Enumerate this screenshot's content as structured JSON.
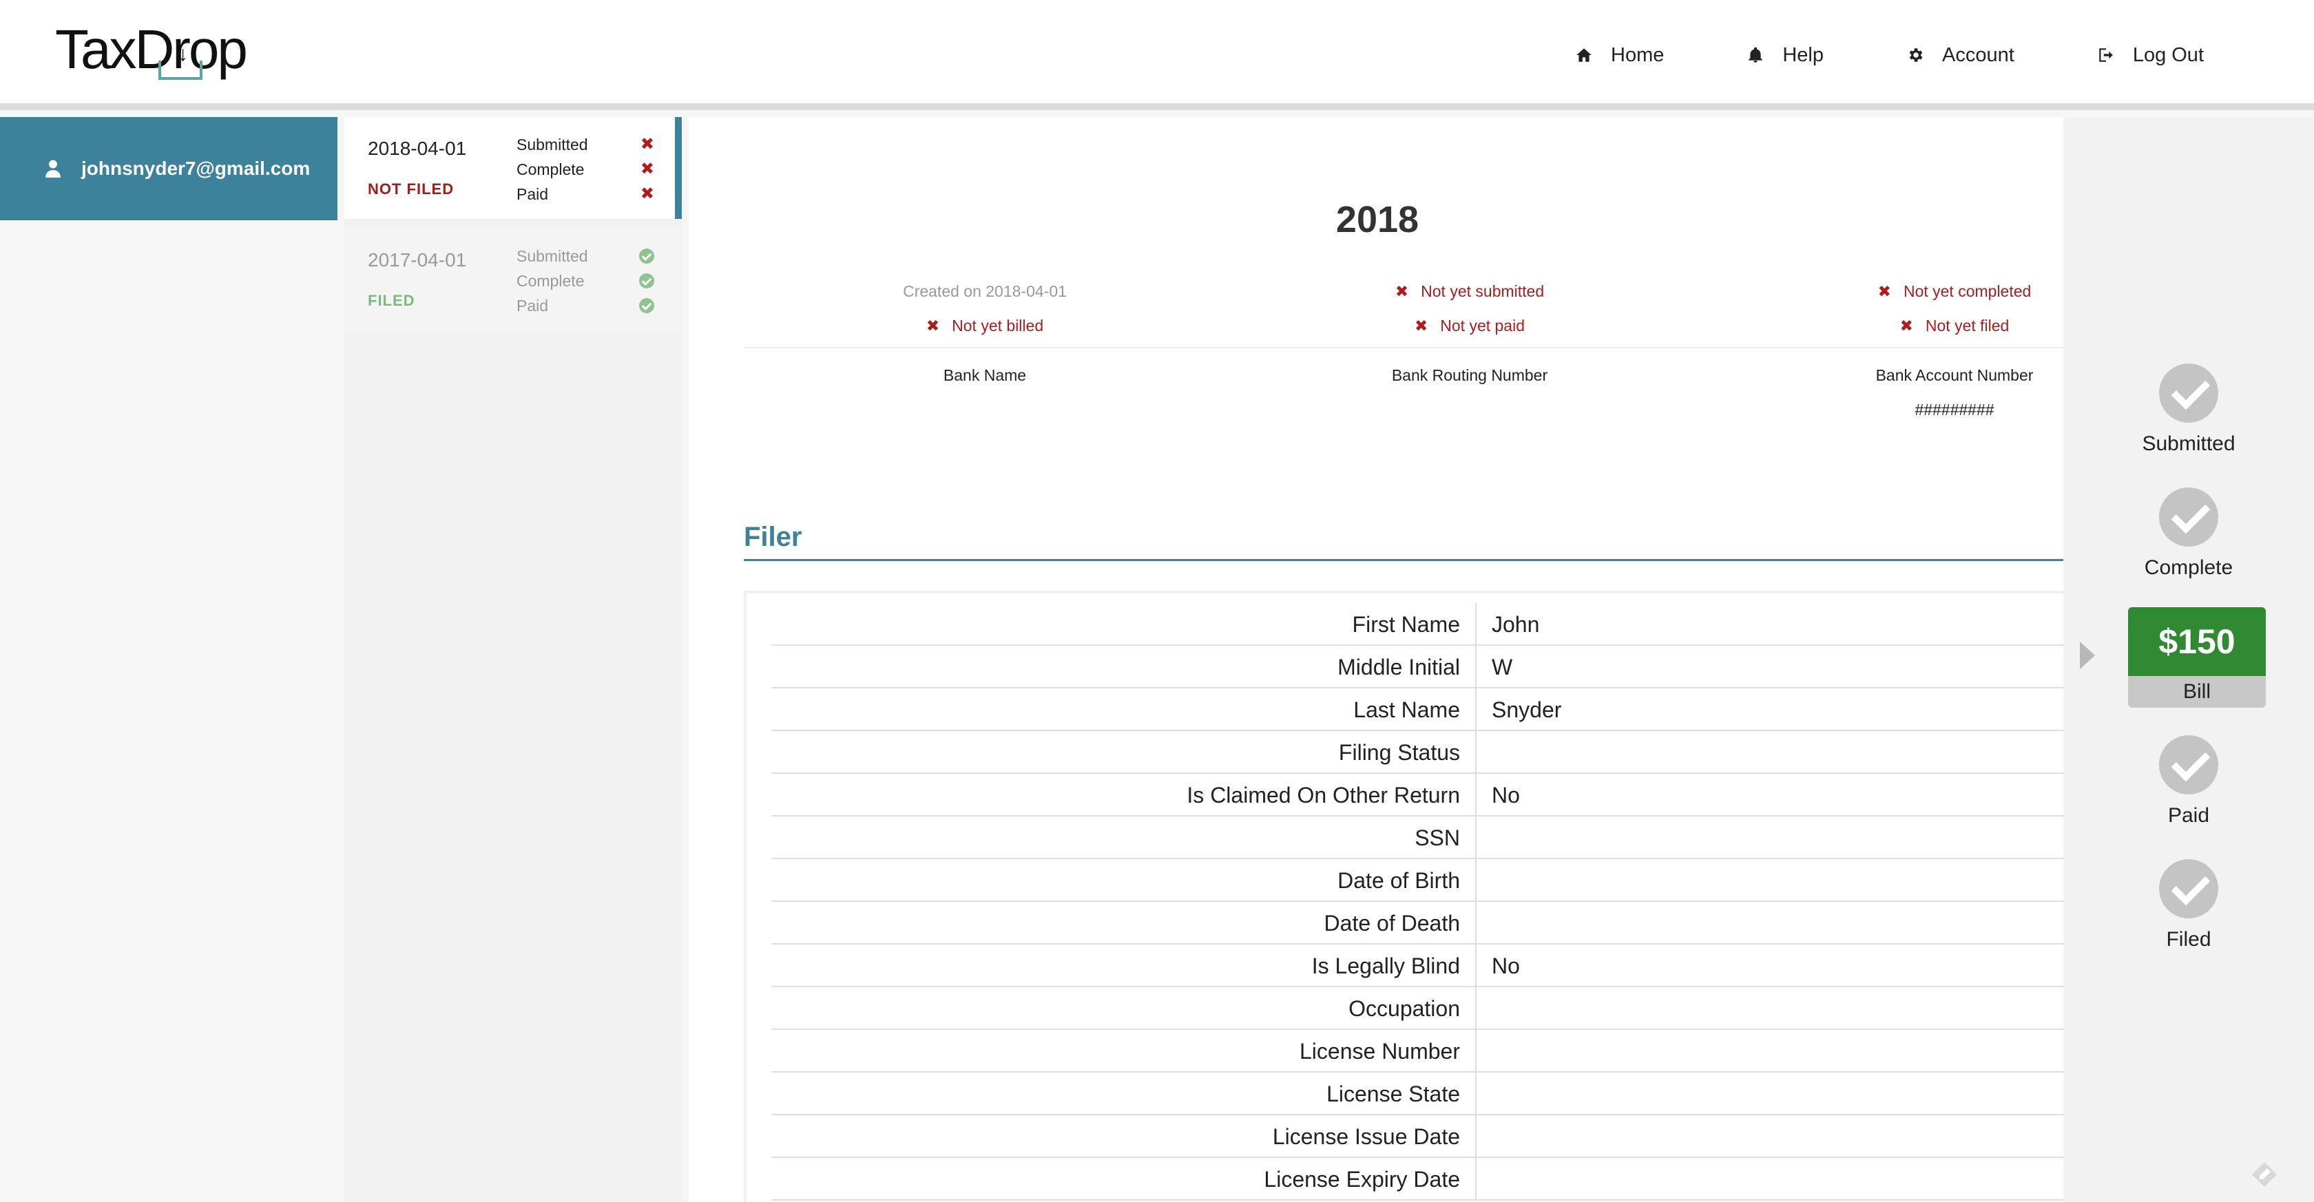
{
  "app": {
    "logo_text": "TaxDrop"
  },
  "nav": {
    "items": [
      {
        "label": "Home",
        "icon": "home-icon"
      },
      {
        "label": "Help",
        "icon": "bell-icon"
      },
      {
        "label": "Account",
        "icon": "gear-icon"
      },
      {
        "label": "Log Out",
        "icon": "logout-icon"
      }
    ]
  },
  "user": {
    "email": "johnsnyder7@gmail.com"
  },
  "returns": [
    {
      "date": "2018-04-01",
      "status": "NOT FILED",
      "steps": [
        {
          "label": "Submitted",
          "done": false
        },
        {
          "label": "Complete",
          "done": false
        },
        {
          "label": "Paid",
          "done": false
        }
      ]
    },
    {
      "date": "2017-04-01",
      "status": "FILED",
      "steps": [
        {
          "label": "Submitted",
          "done": true
        },
        {
          "label": "Complete",
          "done": true
        },
        {
          "label": "Paid",
          "done": true
        }
      ]
    }
  ],
  "detail": {
    "year": "2018",
    "created": "Created on 2018-04-01",
    "not_billed": "Not yet billed",
    "not_submitted": "Not yet submitted",
    "not_paid": "Not yet paid",
    "not_completed": "Not yet completed",
    "not_filed": "Not yet filed",
    "bank_name_label": "Bank Name",
    "routing_label": "Bank Routing Number",
    "account_label": "Bank Account Number",
    "account_value": "#########",
    "section_title": "Filer"
  },
  "filer_rows": [
    {
      "label": "First Name",
      "value": "John"
    },
    {
      "label": "Middle Initial",
      "value": "W"
    },
    {
      "label": "Last Name",
      "value": "Snyder"
    },
    {
      "label": "Filing Status",
      "value": ""
    },
    {
      "label": "Is Claimed On Other Return",
      "value": "No"
    },
    {
      "label": "SSN",
      "value": ""
    },
    {
      "label": "Date of Birth",
      "value": ""
    },
    {
      "label": "Date of Death",
      "value": ""
    },
    {
      "label": "Is Legally Blind",
      "value": "No"
    },
    {
      "label": "Occupation",
      "value": ""
    },
    {
      "label": "License Number",
      "value": ""
    },
    {
      "label": "License State",
      "value": ""
    },
    {
      "label": "License Issue Date",
      "value": ""
    },
    {
      "label": "License Expiry Date",
      "value": ""
    }
  ],
  "progress": {
    "submitted": "Submitted",
    "complete": "Complete",
    "bill_amount": "$150",
    "bill_label": "Bill",
    "paid": "Paid",
    "filed": "Filed"
  },
  "colors": {
    "accent": "#3c829a",
    "error": "#a81e1e",
    "success": "#2f8a32",
    "filed_green": "#7dbb7d"
  }
}
